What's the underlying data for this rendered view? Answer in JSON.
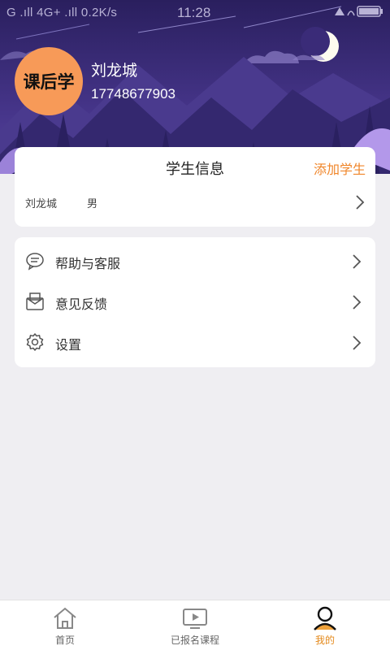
{
  "status_bar": {
    "left": "G .ıll 4G+ .ıll 0.2K/s",
    "time": "11:28"
  },
  "profile": {
    "avatar_text": "课后学",
    "name": "刘龙城",
    "phone": "17748677903"
  },
  "student_card": {
    "title": "学生信息",
    "add_label": "添加学生",
    "student": {
      "name": "刘龙城",
      "gender": "男"
    }
  },
  "menu": {
    "items": [
      {
        "label": "帮助与客服",
        "icon": "chat-bubble-icon"
      },
      {
        "label": "意见反馈",
        "icon": "mail-inbox-icon"
      },
      {
        "label": "设置",
        "icon": "gear-icon"
      }
    ]
  },
  "tabbar": {
    "tabs": [
      {
        "label": "首页",
        "icon": "home-icon",
        "active": false
      },
      {
        "label": "已报名课程",
        "icon": "video-play-icon",
        "active": false
      },
      {
        "label": "我的",
        "icon": "user-icon",
        "active": true
      }
    ],
    "active_color": "#e4891b"
  },
  "colors": {
    "accent": "#f0862a",
    "avatar_bg": "#f79a58",
    "header_bg": "#3e2f7a"
  }
}
